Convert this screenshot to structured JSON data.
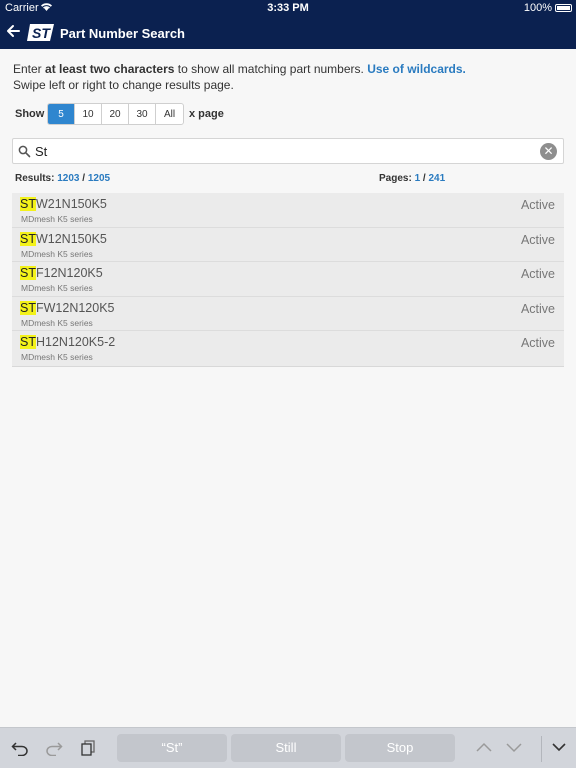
{
  "status_bar": {
    "carrier": "Carrier",
    "time": "3:33 PM",
    "battery": "100%"
  },
  "nav": {
    "title": "Part Number Search",
    "logo_text": "ST",
    "brand_color": "#0b2150"
  },
  "intro": {
    "pre": "Enter ",
    "bold": "at least two characters",
    "post": " to show all matching part numbers. ",
    "link": "Use of wildcards.",
    "line2": "Swipe left or right to change results page."
  },
  "show": {
    "label": "Show",
    "options": [
      "5",
      "10",
      "20",
      "30",
      "All"
    ],
    "selected": "5",
    "suffix": "x page"
  },
  "search": {
    "value": "St",
    "placeholder": ""
  },
  "results": {
    "label": "Results:",
    "shown": "1203",
    "sep": "/",
    "total": "1205",
    "pages_label": "Pages:",
    "page": "1",
    "pages_total": "241"
  },
  "items": [
    {
      "highlight": "ST",
      "rest": "W21N150K5",
      "series": "MDmesh K5 series",
      "status": "Active"
    },
    {
      "highlight": "ST",
      "rest": "W12N150K5",
      "series": "MDmesh K5 series",
      "status": "Active"
    },
    {
      "highlight": "ST",
      "rest": "F12N120K5",
      "series": "MDmesh K5 series",
      "status": "Active"
    },
    {
      "highlight": "ST",
      "rest": "FW12N120K5",
      "series": "MDmesh K5 series",
      "status": "Active"
    },
    {
      "highlight": "ST",
      "rest": "H12N120K5-2",
      "series": "MDmesh K5 series",
      "status": "Active"
    }
  ],
  "keyboard_bar": {
    "suggestions": [
      "“St”",
      "Still",
      "Stop"
    ],
    "icons": [
      "undo-icon",
      "redo-icon",
      "paste-icon",
      "chevron-up-icon",
      "chevron-down-icon",
      "dismiss-keyboard-icon"
    ]
  }
}
